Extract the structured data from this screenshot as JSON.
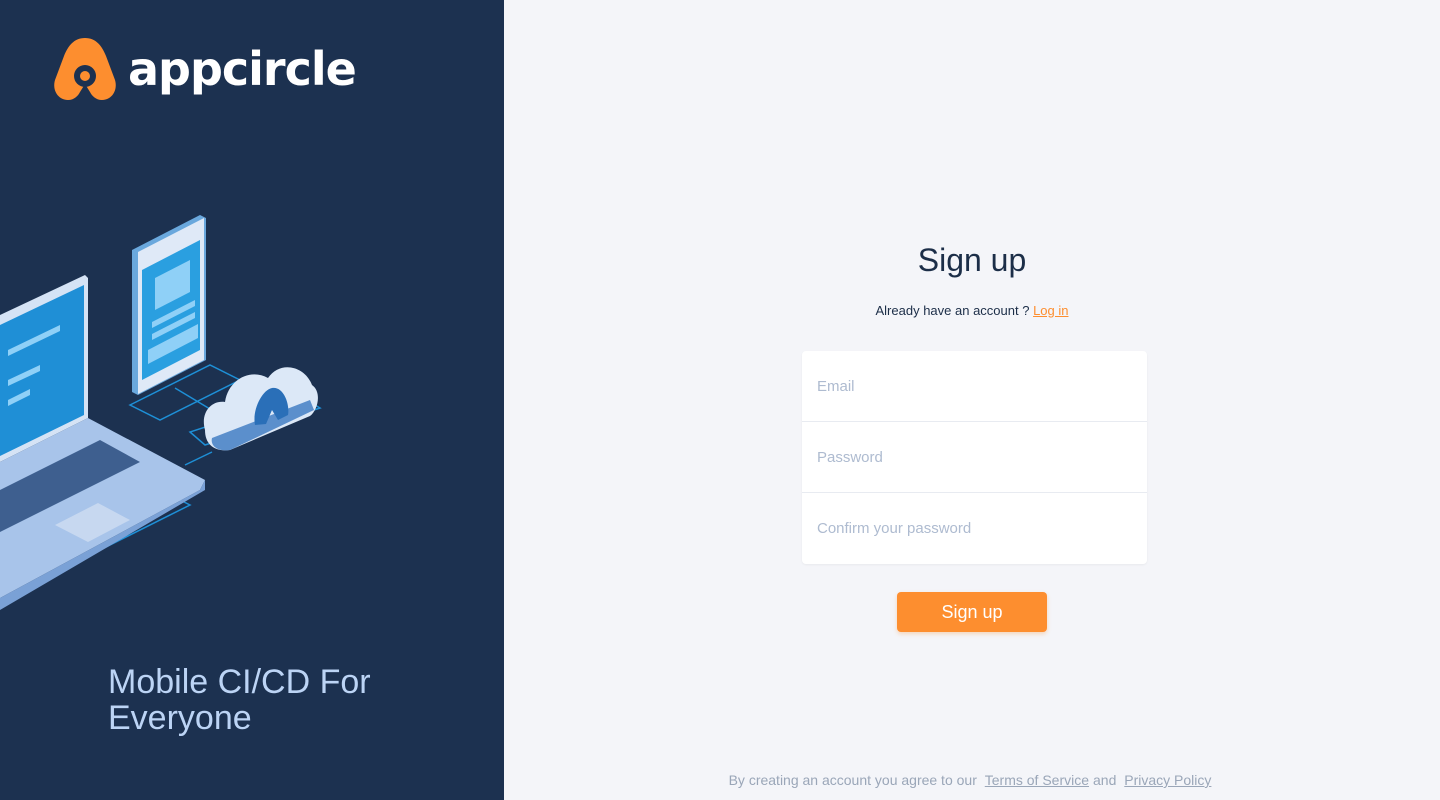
{
  "brand": {
    "name": "appcircle",
    "tagline": "Mobile CI/CD For Everyone",
    "colors": {
      "accent": "#fd8e2f",
      "panel": "#1c3150",
      "background": "#f4f5f9"
    }
  },
  "form": {
    "title": "Sign up",
    "already_text": "Already have an account ?",
    "login_link": "Log in",
    "email_placeholder": "Email",
    "password_placeholder": "Password",
    "confirm_placeholder": "Confirm your password",
    "submit_label": "Sign up"
  },
  "footer": {
    "text": "By creating an account you agree to our",
    "terms_link": "Terms of Service",
    "and_text": "and",
    "privacy_link": "Privacy Policy"
  }
}
